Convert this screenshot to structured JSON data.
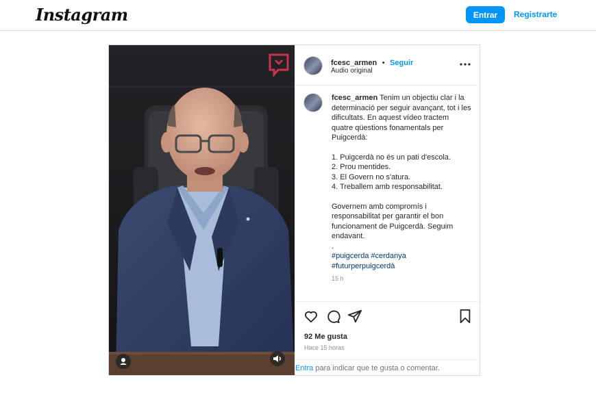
{
  "header": {
    "logo_text": "Instagram",
    "login_label": "Entrar",
    "register_label": "Registrarte",
    "colors": {
      "accent": "#0095f6",
      "border": "#dbdbdb"
    }
  },
  "post": {
    "username": "fcesc_armen",
    "separator": "•",
    "follow_label": "Seguir",
    "audio_label": "Audio original",
    "caption": {
      "username": "fcesc_armen",
      "intro": "Tenim un objectiu clar i la determinació per seguir avançant, tot i les dificultats. En aquest vídeo tractem quatre qüestions fonamentals per Puigcerdà:",
      "points": [
        "1. Puigcerdà no és un pati d'escola.",
        "2. Prou mentides.",
        "3. El Govern no s'atura.",
        "4. Treballem amb responsabilitat."
      ],
      "closing": "Governem amb compromís i responsabilitat per garantir el bon funcionament de Puigcerdà. Seguim endavant.",
      "dot": ".",
      "hashtags": [
        "#puigcerda",
        "#cerdanya",
        "#futurperpuigcerdà"
      ],
      "time_ago": "15 h"
    },
    "likes": "92 Me gusta",
    "posted": "Hace 15 horas",
    "comment_prompt": {
      "link": "Entra",
      "rest": " para indicar que te gusta o comentar."
    },
    "icons": [
      "like-icon",
      "comment-icon",
      "share-icon",
      "save-icon",
      "more-options-icon",
      "user-tag-icon",
      "volume-icon",
      "channel-logo-icon"
    ]
  }
}
